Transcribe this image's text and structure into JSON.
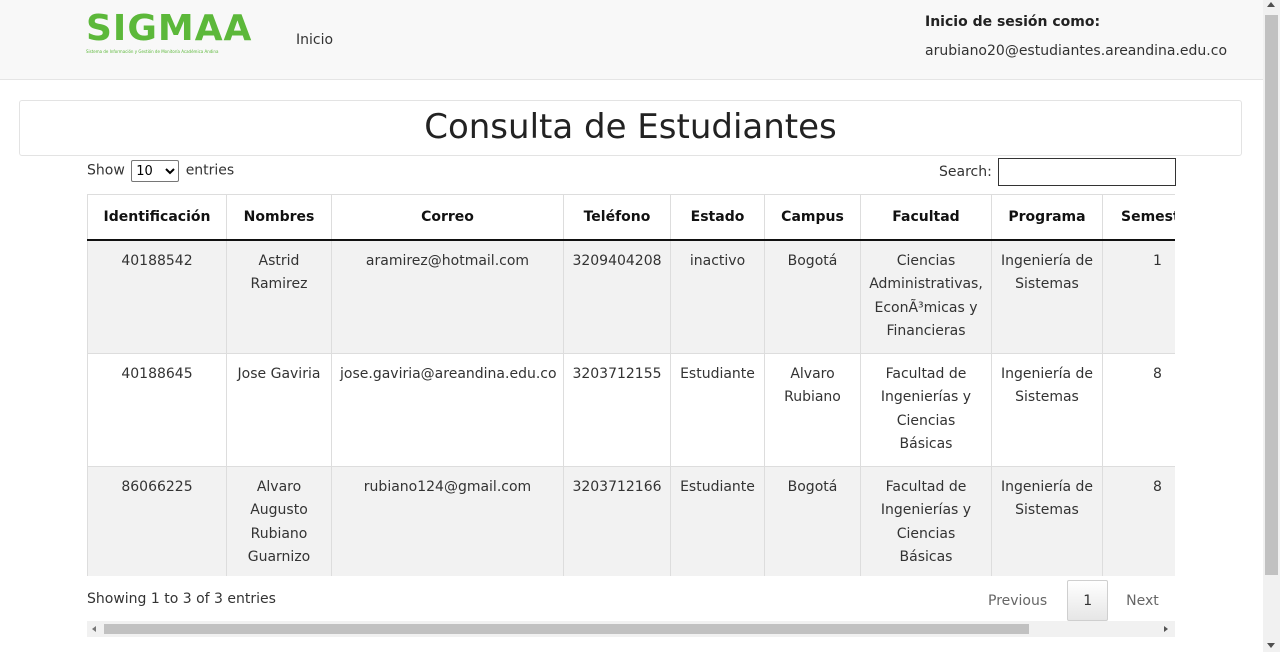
{
  "navbar": {
    "logo_text": "SIGMAA",
    "logo_subtitle": "Sistema de Información y Gestión de Monitoría Académica Andina",
    "home_link": "Inicio",
    "login_label": "Inicio de sesión como:",
    "login_email": "arubiano20@estudiantes.areandina.edu.co"
  },
  "page": {
    "title": "Consulta de Estudiantes"
  },
  "controls": {
    "show_label": "Show",
    "entries_value": "10",
    "entries_label": "entries",
    "search_label": "Search:",
    "search_value": ""
  },
  "table": {
    "columns": [
      "Identificación",
      "Nombres",
      "Correo",
      "Teléfono",
      "Estado",
      "Campus",
      "Facultad",
      "Programa",
      "Semest"
    ],
    "rows": [
      {
        "id": "40188542",
        "nombres": "Astrid Ramirez",
        "correo": "aramirez@hotmail.com",
        "telefono": "3209404208",
        "estado": "inactivo",
        "campus": "Bogotá",
        "facultad": "Ciencias Administrativas, EconÃ³micas y Financieras",
        "programa": "Ingeniería de Sistemas",
        "semestre": "1"
      },
      {
        "id": "40188645",
        "nombres": "Jose Gaviria",
        "correo": "jose.gaviria@areandina.edu.co",
        "telefono": "3203712155",
        "estado": "Estudiante",
        "campus": "Alvaro Rubiano",
        "facultad": "Facultad de Ingenierías y Ciencias Básicas",
        "programa": "Ingeniería de Sistemas",
        "semestre": "8"
      },
      {
        "id": "86066225",
        "nombres": "Alvaro Augusto Rubiano Guarnizo",
        "correo": "rubiano124@gmail.com",
        "telefono": "3203712166",
        "estado": "Estudiante",
        "campus": "Bogotá",
        "facultad": "Facultad de Ingenierías y Ciencias Básicas",
        "programa": "Ingeniería de Sistemas",
        "semestre": "8"
      }
    ]
  },
  "footer": {
    "info": "Showing 1 to 3 of 3 entries",
    "previous": "Previous",
    "page": "1",
    "next": "Next"
  }
}
